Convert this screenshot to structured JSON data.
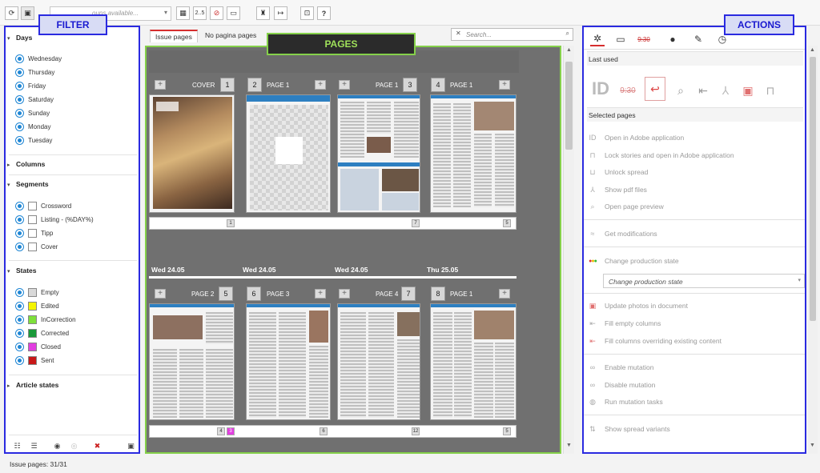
{
  "toolbar": {
    "groups_placeholder": "oups available...",
    "btn_range": "2..5"
  },
  "filter": {
    "label": "FILTER",
    "days_title": "Days",
    "days": [
      "Wednesday",
      "Thursday",
      "Friday",
      "Saturday",
      "Sunday",
      "Monday",
      "Tuesday"
    ],
    "columns_title": "Columns",
    "segments_title": "Segments",
    "segments": [
      "Crossword",
      "Listing - (%DAY%)",
      "Tipp",
      "Cover"
    ],
    "states_title": "States",
    "states": [
      {
        "label": "Empty",
        "color": "#d9d9d9"
      },
      {
        "label": "Edited",
        "color": "#f4f400"
      },
      {
        "label": "InCorrection",
        "color": "#7ee03a"
      },
      {
        "label": "Corrected",
        "color": "#1a9a3a"
      },
      {
        "label": "Closed",
        "color": "#e23ee0"
      },
      {
        "label": "Sent",
        "color": "#c81818"
      }
    ],
    "article_states_title": "Article states"
  },
  "center": {
    "tabs": [
      "Issue pages",
      "No pagina pages"
    ],
    "search_placeholder": "Search...",
    "pages_label": "PAGES",
    "row1": [
      {
        "num": "1",
        "name": "COVER",
        "count": "1"
      },
      {
        "num": "2",
        "name": "PAGE 1",
        "count": ""
      },
      {
        "num": "3",
        "name": "PAGE 1",
        "count": "7"
      },
      {
        "num": "4",
        "name": "PAGE 1",
        "count": "5"
      }
    ],
    "dates": [
      "Wed 24.05",
      "Wed 24.05",
      "Wed 24.05",
      "Thu 25.05"
    ],
    "row2": [
      {
        "num": "5",
        "name": "PAGE 2",
        "count": "4",
        "count2": "3"
      },
      {
        "num": "6",
        "name": "PAGE 3",
        "count": "6"
      },
      {
        "num": "7",
        "name": "PAGE 4",
        "count": "12"
      },
      {
        "num": "8",
        "name": "PAGE 1",
        "count": "5"
      }
    ]
  },
  "actions": {
    "label": "ACTIONS",
    "last_used": "Last used",
    "selected_pages": "Selected pages",
    "items_group1": [
      "Open in Adobe application",
      "Lock stories and open in Adobe application",
      "Unlock spread",
      "Show pdf files",
      "Open page preview"
    ],
    "get_modifications": "Get modifications",
    "change_production_state": "Change production state",
    "production_select": "Change production state",
    "items_group3": [
      "Update photos in document",
      "Fill empty columns",
      "Fill columns overriding existing content"
    ],
    "items_group4": [
      "Enable mutation",
      "Disable mutation",
      "Run mutation tasks"
    ],
    "show_spread_variants": "Show spread variants"
  },
  "status": {
    "text": "Issue pages: 31/31"
  }
}
